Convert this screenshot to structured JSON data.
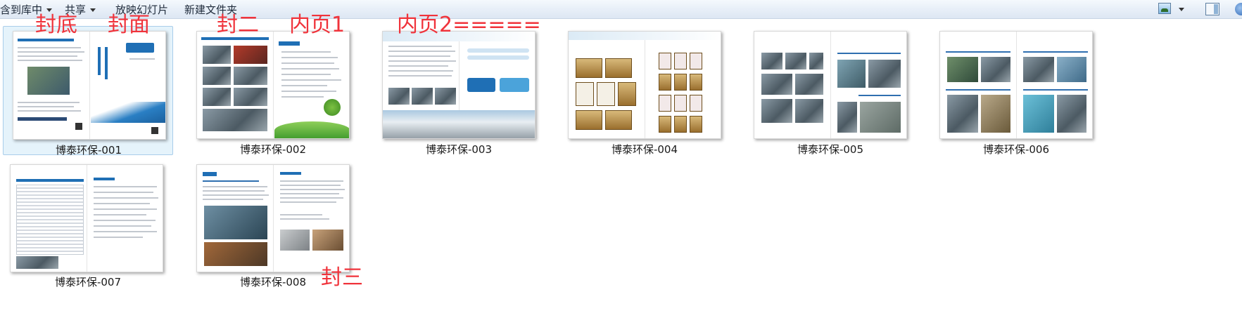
{
  "toolbar": {
    "include_in_library": "含到库中",
    "share": "共享",
    "slideshow": "放映幻灯片",
    "new_folder": "新建文件夹",
    "view_icon": "view-options-icon",
    "preview_pane_icon": "preview-pane-icon",
    "help_icon": "help-icon"
  },
  "files": [
    {
      "name": "博泰环保-001",
      "selected": true
    },
    {
      "name": "博泰环保-002",
      "selected": false
    },
    {
      "name": "博泰环保-003",
      "selected": false
    },
    {
      "name": "博泰环保-004",
      "selected": false
    },
    {
      "name": "博泰环保-005",
      "selected": false
    },
    {
      "name": "博泰环保-006",
      "selected": false
    },
    {
      "name": "博泰环保-007",
      "selected": false
    },
    {
      "name": "博泰环保-008",
      "selected": false
    }
  ],
  "annotations": {
    "back_cover": "封底",
    "front_cover": "封面",
    "cover_two": "封二",
    "inner_page_1": "内页1",
    "inner_page_2": "内页2=====",
    "cover_three": "封三"
  },
  "colors": {
    "annotation_red": "#f0333b",
    "selection_bg": "#e5f3fb",
    "brand_blue": "#1f6fb5"
  }
}
